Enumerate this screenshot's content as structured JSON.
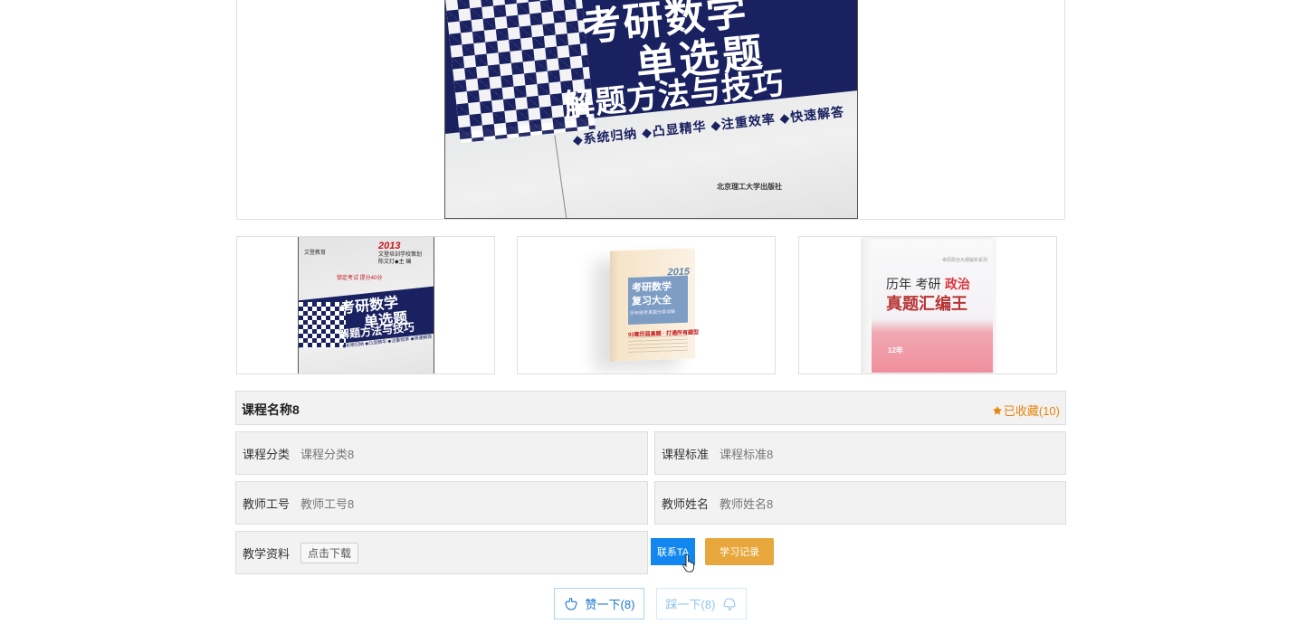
{
  "main_image": {
    "title_line1": "考研数学",
    "title_line2": "单选题",
    "title_line3": "解题方法与技巧",
    "features": "◆系统归纳 ◆凸显精华 ◆注重效率 ◆快速解答",
    "publisher": "北京理工大学出版社"
  },
  "thumbnails": [
    {
      "year": "2013",
      "subtitle_lines": "文登培训学校策划\n陈文灯◆主 编",
      "logo": "文登教育",
      "red_note": "锁定考试 提分40分",
      "title_line1": "考研数学",
      "title_line2": "单选题",
      "title_line3": "解题方法与技巧",
      "features": "◆系统归纳 ◆凸显精华 ◆注重效率 ◆快速解答"
    },
    {
      "year": "2015",
      "title_line1": "考研数学",
      "title_line2": "复习大全",
      "band_note": "历年统考真题分类详解",
      "count_note": "93套历届真题 · 打通所有题型"
    },
    {
      "series": "考研政治大纲解析系列",
      "title_line1_a": "历年 考研 ",
      "title_line1_b": "政治",
      "title_line2": "真题汇编王",
      "count": "12年"
    }
  ],
  "course": {
    "title": "课程名称8",
    "favorite_label": "已收藏(10)",
    "fields": {
      "category_label": "课程分类",
      "category_value": "课程分类8",
      "standard_label": "课程标准",
      "standard_value": "课程标准8",
      "teacher_id_label": "教师工号",
      "teacher_id_value": "教师工号8",
      "teacher_name_label": "教师姓名",
      "teacher_name_value": "教师姓名8",
      "material_label": "教学资料",
      "download_label": "点击下载"
    },
    "contact_label": "联系TA",
    "record_label": "学习记录",
    "like_label": "赞一下(8)",
    "dislike_label": "踩一下(8)"
  },
  "colors": {
    "accent_blue": "#1287f0",
    "accent_orange": "#e8a73c",
    "favorite_orange": "#e8840c",
    "cover_navy": "#1a2160"
  },
  "icons": {
    "favorite": "star-icon",
    "like": "thumb-up-icon",
    "dislike": "thumb-down-icon",
    "cursor": "hand-pointer-icon"
  }
}
